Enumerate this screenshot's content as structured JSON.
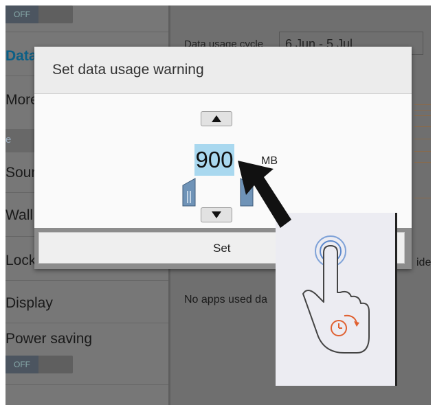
{
  "settings_list": {
    "items": [
      "Data",
      "More",
      "Sound",
      "Wall",
      "Lock",
      "Display",
      "Power saving"
    ],
    "top_toggle": "OFF",
    "power_toggle": "OFF"
  },
  "usage": {
    "cycle_label": "Data usage cycle",
    "cycle_value": "6 Jun - 5 Jul",
    "no_apps": "No apps used da",
    "ider": "ider"
  },
  "dialog": {
    "title": "Set data usage warning",
    "value": "900",
    "unit": "MB",
    "set_label": "Set"
  },
  "colors": {
    "active_item": "#0b5f86",
    "number_highlight": "#a9d8ef",
    "ripple": "#3c6fc8",
    "timer_accent": "#e06030"
  },
  "icons": [
    "up-arrow-icon",
    "down-arrow-icon",
    "pointer-arrow-icon",
    "tap-hand-icon",
    "timer-icon"
  ]
}
